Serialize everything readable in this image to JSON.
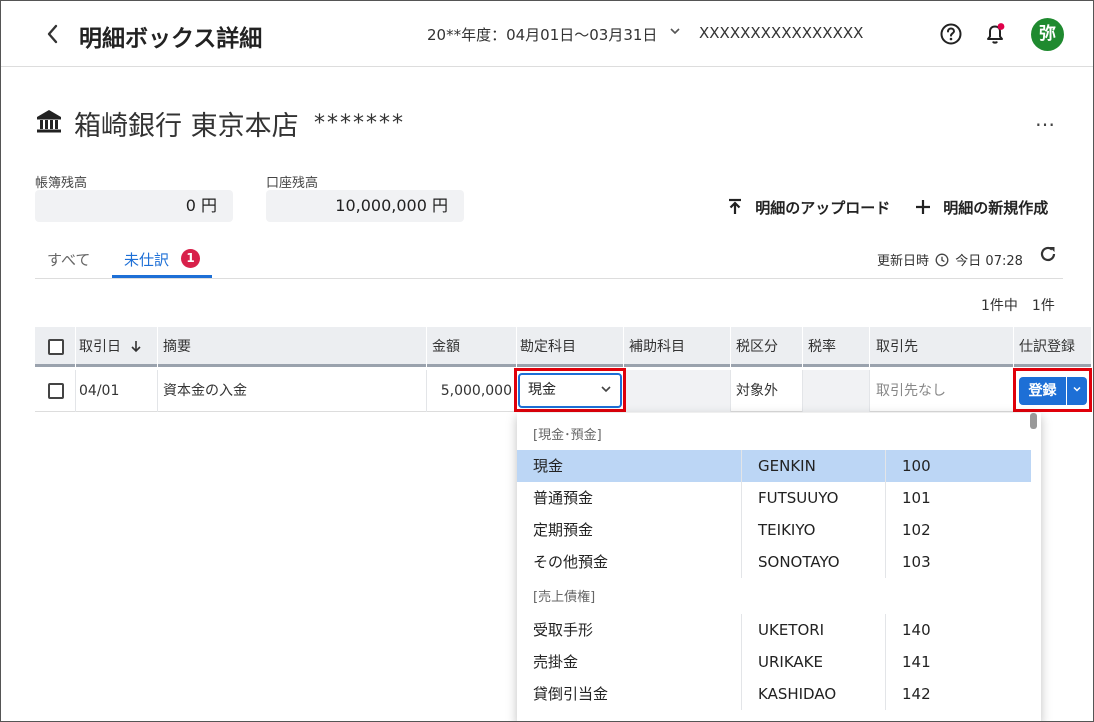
{
  "header": {
    "back_label": "<",
    "title": "明細ボックス詳細",
    "period": "20**年度：04月01日〜03月31日",
    "company": "XXXXXXXXXXXXXXXX",
    "avatar_text": "弥",
    "avatar_color": "#1f8a2f",
    "icons": [
      "back-icon",
      "help-icon",
      "bell-icon"
    ]
  },
  "bank": {
    "name": "箱崎銀行 東京本店",
    "masked_number": "*******",
    "more_label": "…"
  },
  "balances": {
    "book_label": "帳簿残高",
    "book_value": "0 円",
    "account_label": "口座残高",
    "account_value": "10,000,000 円"
  },
  "actions": {
    "upload_label": "明細のアップロード",
    "new_label": "明細の新規作成"
  },
  "tabs": {
    "all_label": "すべて",
    "unprocessed_label": "未仕訳",
    "unprocessed_badge": "1"
  },
  "status": {
    "updated_label": "更新日時",
    "updated_value": "今日 07:28",
    "count": "1件中　1件"
  },
  "table": {
    "headers": {
      "date": "取引日",
      "description": "摘要",
      "amount": "金額",
      "account": "勘定科目",
      "sub_account": "補助科目",
      "tax_category": "税区分",
      "tax_rate": "税率",
      "partner": "取引先",
      "register": "仕訳登録"
    },
    "row": {
      "date": "04/01",
      "description": "資本金の入金",
      "amount": "5,000,000",
      "account": "現金",
      "tax_category": "対象外",
      "partner": "取引先なし",
      "register_label": "登録"
    }
  },
  "dropdown": {
    "groups": [
      {
        "label": "[現金･預金]",
        "options": [
          {
            "name": "現金",
            "code": "GENKIN",
            "num": "100",
            "selected": true
          },
          {
            "name": "普通預金",
            "code": "FUTSUUYO",
            "num": "101"
          },
          {
            "name": "定期預金",
            "code": "TEIKIYO",
            "num": "102"
          },
          {
            "name": "その他預金",
            "code": "SONOTAYO",
            "num": "103"
          }
        ]
      },
      {
        "label": "[売上債権]",
        "options": [
          {
            "name": "受取手形",
            "code": "UKETORI",
            "num": "140"
          },
          {
            "name": "売掛金",
            "code": "URIKAKE",
            "num": "141"
          },
          {
            "name": "貸倒引当金",
            "code": "KASHIDAO",
            "num": "142"
          }
        ]
      }
    ]
  },
  "colors": {
    "accent": "#1d6fd6",
    "badge": "#d8204a",
    "highlight_outline": "#e0000a",
    "selected_option": "#bcd6f5"
  }
}
